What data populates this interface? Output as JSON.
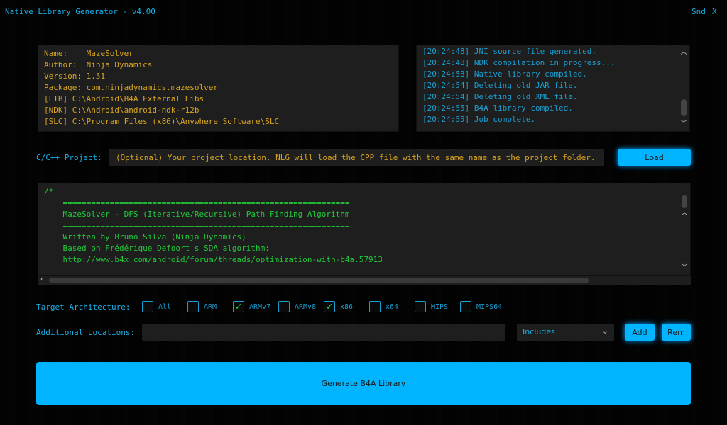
{
  "window": {
    "title": "Native Library Generator - v4.00",
    "snd_label": "Snd",
    "close_label": "X"
  },
  "info": [
    "Name:    MazeSolver",
    "Author:  Ninja Dynamics",
    "Version: 1.51",
    "Package: com.ninjadynamics.mazesolver",
    "[LIB] C:\\Android\\B4A External Libs",
    "[NDK] C:\\Android\\android-ndk-r12b",
    "[SLC] C:\\Program Files (x86)\\Anywhere Software\\SLC"
  ],
  "log": [
    "[20:24:48] JNI source file generated.",
    "[20:24:48] NDK compilation in progress...",
    "[20:24:53] Native library compiled.",
    "[20:24:54] Deleting old JAR file.",
    "[20:24:54] Deleting old XML file.",
    "[20:24:55] B4A library compiled.",
    "[20:24:55] Job complete."
  ],
  "project": {
    "label": "C/C++ Project:",
    "placeholder": "(Optional) Your project location. NLG will load the CPP file with the same name as the project folder.",
    "load_label": "Load"
  },
  "code": [
    "/*",
    "    =============================================================",
    "    MazeSolver - DFS (Iterative/Recursive) Path Finding Algorithm",
    "    =============================================================",
    "    Written by Bruno Silva (Ninja Dynamics)",
    "    Based on Frédérique Defoort's SDA algorithm:",
    "    http://www.b4x.com/android/forum/threads/optimization-with-b4a.57913"
  ],
  "arch": {
    "label": "Target Architecture:",
    "options": [
      {
        "label": "All",
        "checked": false
      },
      {
        "label": "ARM",
        "checked": false
      },
      {
        "label": "ARMv7",
        "checked": true
      },
      {
        "label": "ARMv8",
        "checked": false
      },
      {
        "label": "x86",
        "checked": true
      },
      {
        "label": "x64",
        "checked": false
      },
      {
        "label": "MIPS",
        "checked": false
      },
      {
        "label": "MIPS64",
        "checked": false
      }
    ]
  },
  "locations": {
    "label": "Additional Locations:",
    "value": "",
    "select": "Includes",
    "add_label": "Add",
    "rem_label": "Rem"
  },
  "generate_label": "Generate B4A Library",
  "colors": {
    "accent": "#00b4ff",
    "info": "#d8a520",
    "log": "#1a9fd2",
    "code": "#22c93a"
  }
}
